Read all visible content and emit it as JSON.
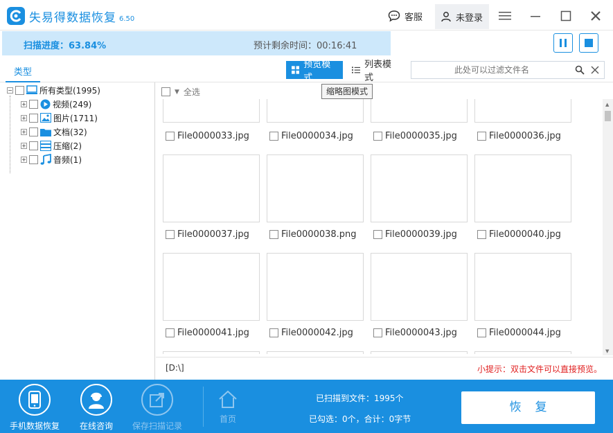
{
  "app": {
    "title": "失易得数据恢复",
    "version": "6.50",
    "service_label": "客服",
    "login_label": "未登录",
    "accent_color": "#1a8fe0"
  },
  "progress": {
    "label": "扫描进度：63.84%",
    "percent": 63.84,
    "remaining": "预计剩余时间：00:16:41"
  },
  "toolbar": {
    "type_tab": "类型",
    "preview_mode": "预览模式",
    "list_mode": "列表模式",
    "filter_placeholder": "此处可以过滤文件名",
    "tooltip": "缩略图模式"
  },
  "tree": {
    "root": "所有类型(1995)",
    "children": [
      {
        "label": "视频(249)",
        "icon": "video-icon"
      },
      {
        "label": "图片(1711)",
        "icon": "image-icon"
      },
      {
        "label": "文档(32)",
        "icon": "folder-icon"
      },
      {
        "label": "压缩(2)",
        "icon": "archive-icon"
      },
      {
        "label": "音频(1)",
        "icon": "music-icon"
      }
    ]
  },
  "grid": {
    "select_all": "全选",
    "files": [
      "File0000033.jpg",
      "File0000034.jpg",
      "File0000035.jpg",
      "File0000036.jpg",
      "File0000037.jpg",
      "File0000038.png",
      "File0000039.jpg",
      "File0000040.jpg",
      "File0000041.jpg",
      "File0000042.jpg",
      "File0000043.jpg",
      "File0000044.jpg"
    ]
  },
  "status": {
    "path": "[D:\\]",
    "hint": "小提示：双击文件可以直接预览。"
  },
  "bottom": {
    "phone_recovery": "手机数据恢复",
    "online_consult": "在线咨询",
    "save_record": "保存扫描记录",
    "home": "首页",
    "scanned": "已扫描到文件：1995个",
    "selected": "已勾选：0个，合计：0字节",
    "restore": "恢复"
  }
}
